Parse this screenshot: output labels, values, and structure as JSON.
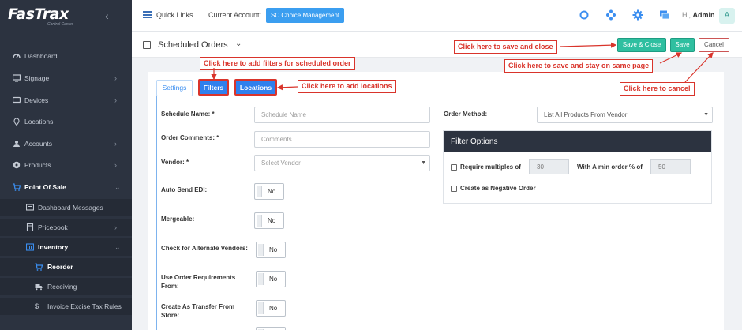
{
  "sidebar": {
    "logo": "FasTrax",
    "logo_sub": "Control Center",
    "items": [
      {
        "label": "Dashboard",
        "icon": "dashboard-icon"
      },
      {
        "label": "Signage",
        "icon": "monitor-icon"
      },
      {
        "label": "Devices",
        "icon": "devices-icon"
      },
      {
        "label": "Locations",
        "icon": "location-pin-icon"
      },
      {
        "label": "Accounts",
        "icon": "users-icon"
      },
      {
        "label": "Products",
        "icon": "products-icon"
      },
      {
        "label": "Point Of Sale",
        "icon": "cart-icon"
      },
      {
        "label": "Dashboard Messages",
        "icon": "message-icon"
      },
      {
        "label": "Pricebook",
        "icon": "book-icon"
      },
      {
        "label": "Inventory",
        "icon": "inventory-icon"
      },
      {
        "label": "Reorder",
        "icon": "cart-icon"
      },
      {
        "label": "Receiving",
        "icon": "truck-icon"
      },
      {
        "label": "Invoice Excise Tax Rules",
        "icon": "dollar-icon"
      }
    ]
  },
  "topbar": {
    "quick_links": "Quick Links",
    "current_account_label": "Current Account:",
    "current_account_value": "SC Choice Management",
    "greeting": "Hi,",
    "user": "Admin",
    "avatar_letter": "A"
  },
  "header": {
    "title": "Scheduled Orders",
    "save_close": "Save & Close",
    "save": "Save",
    "cancel": "Cancel"
  },
  "tabs": {
    "settings": "Settings",
    "filters": "Filters",
    "locations": "Locations"
  },
  "form": {
    "schedule_name_label": "Schedule Name: *",
    "schedule_name_placeholder": "Schedule Name",
    "order_comments_label": "Order Comments: *",
    "order_comments_placeholder": "Comments",
    "vendor_label": "Vendor: *",
    "vendor_placeholder": "Select Vendor",
    "auto_send_label": "Auto Send EDI:",
    "mergeable_label": "Mergeable:",
    "alt_vendors_label": "Check for Alternate Vendors:",
    "order_req_label_1": "Use Order Requirements",
    "order_req_label_2": "From:",
    "transfer_label_1": "Create As Transfer From",
    "transfer_label_2": "Store:",
    "toggle_no": "No",
    "order_method_label": "Order Method:",
    "order_method_value": "List All Products From Vendor"
  },
  "filter_options": {
    "title": "Filter Options",
    "require_multiples_label": "Require multiples of",
    "require_multiples_value": "30",
    "min_order_label": "With A min order % of",
    "min_order_value": "50",
    "negative_order_label": "Create as Negative Order"
  },
  "annotations": {
    "filters": "Click here to add filters for scheduled order",
    "locations": "Click here to add locations",
    "save_close": "Click here to save and close",
    "save": "Click here to save and stay on same page",
    "cancel": "Click here to cancel"
  },
  "colors": {
    "accent": "#3b9ef0",
    "teal": "#2fbfa0",
    "annotation": "#d9342b",
    "sidebar": "#2c3340"
  }
}
